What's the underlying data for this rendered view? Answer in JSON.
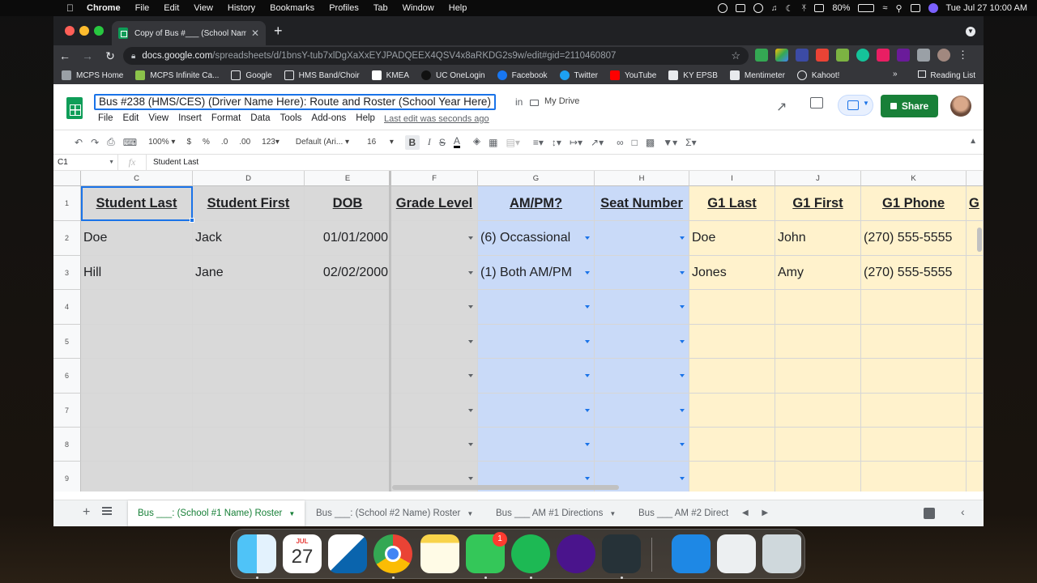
{
  "menubar": {
    "app": "Chrome",
    "items": [
      "File",
      "Edit",
      "View",
      "History",
      "Bookmarks",
      "Profiles",
      "Tab",
      "Window",
      "Help"
    ],
    "battery": "80%",
    "clock": "Tue Jul 27  10:00 AM"
  },
  "browser": {
    "tab_title": "Copy of Bus #___ (School Nam",
    "url_host": "docs.google.com",
    "url_path": "/spreadsheets/d/1bnsY-tub7xlDgXaXxEYJPADQEEX4QSV4x8aRKDG2s9w/edit#gid=2110460807",
    "bookmarks": [
      "MCPS Home",
      "MCPS Infinite Ca...",
      "Google",
      "HMS Band/Choir",
      "KMEA",
      "UC OneLogin",
      "Facebook",
      "Twitter",
      "YouTube",
      "KY EPSB",
      "Mentimeter",
      "Kahoot!"
    ],
    "reading_list": "Reading List"
  },
  "doc": {
    "title": "Bus #238 (HMS/CES) (Driver Name Here): Route and Roster (School Year Here)",
    "in": "in",
    "folder": "My Drive",
    "menu": [
      "File",
      "Edit",
      "View",
      "Insert",
      "Format",
      "Data",
      "Tools",
      "Add-ons",
      "Help"
    ],
    "last_edit": "Last edit was seconds ago",
    "share": "Share"
  },
  "edit_toolbar": {
    "zoom": "100%",
    "currency": "$",
    "percent": "%",
    "dec_less": ".0",
    "dec_more": ".00",
    "more_formats": "123",
    "font": "Default (Ari...",
    "font_size": "16"
  },
  "formula_bar": {
    "name_box": "C1",
    "fx": "fx",
    "content": "Student Last"
  },
  "grid": {
    "columns": [
      "C",
      "D",
      "E",
      "F",
      "G",
      "H",
      "I",
      "J",
      "K"
    ],
    "row_numbers": [
      "1",
      "2",
      "3",
      "4",
      "5",
      "6",
      "7",
      "8",
      "9"
    ],
    "headers": [
      "Student Last",
      "Student First",
      "DOB",
      "Grade Level",
      "AM/PM?",
      "Seat Number",
      "G1 Last",
      "G1 First",
      "G1 Phone",
      "G"
    ],
    "rows": [
      [
        "Doe",
        "Jack",
        "01/01/2000",
        "",
        "(6) Occassional",
        "",
        "Doe",
        "John",
        "(270) 555-5555"
      ],
      [
        "Hill",
        "Jane",
        "02/02/2000",
        "",
        "(1) Both AM/PM",
        "",
        "Jones",
        "Amy",
        "(270) 555-5555"
      ]
    ],
    "colors": {
      "gray": "#d9d9d9",
      "blue": "#c9daf8",
      "yellow": "#fff2cc",
      "selection": "#1a73e8"
    }
  },
  "sheet_tabs": [
    "Bus ___: (School #1 Name) Roster",
    "Bus ___: (School #2 Name) Roster",
    "Bus ___ AM #1 Directions",
    "Bus ___ AM #2 Direct"
  ],
  "dock": {
    "calendar_month": "JUL",
    "calendar_day": "27",
    "messages_badge": "1",
    "apps": [
      "Finder",
      "Calendar",
      "Outlook",
      "Chrome",
      "Notes",
      "Messages",
      "Spotify",
      "Music Notation",
      "QuickTime",
      "App Store",
      "Preview",
      "Trash"
    ]
  }
}
